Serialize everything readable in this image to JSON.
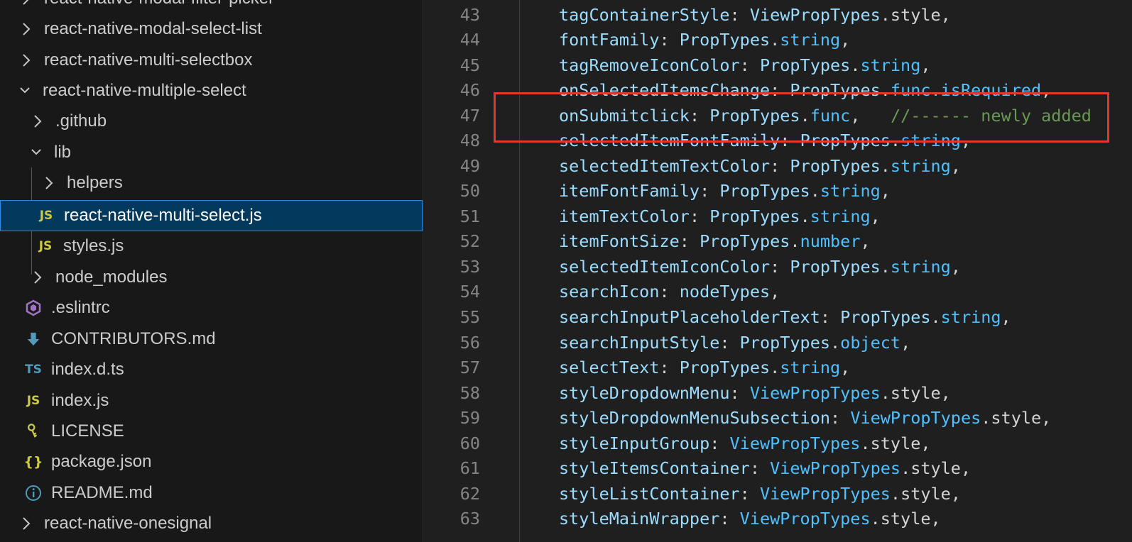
{
  "explorer": {
    "items": [
      {
        "label": "react-native-modal-filter-picker",
        "icon": "chevron-right-icon",
        "kind": "folder"
      },
      {
        "label": "react-native-modal-select-list",
        "icon": "chevron-right-icon",
        "kind": "folder"
      },
      {
        "label": "react-native-multi-selectbox",
        "icon": "chevron-right-icon",
        "kind": "folder"
      },
      {
        "label": "react-native-multiple-select",
        "icon": "chevron-down-icon",
        "kind": "folder"
      },
      {
        "label": ".github",
        "icon": "chevron-right-icon",
        "kind": "folder"
      },
      {
        "label": "lib",
        "icon": "chevron-down-icon",
        "kind": "folder"
      },
      {
        "label": "helpers",
        "icon": "chevron-right-icon",
        "kind": "folder"
      },
      {
        "label": "react-native-multi-select.js",
        "icon": "js-file-icon",
        "badge": "JS",
        "kind": "file",
        "selected": true
      },
      {
        "label": "styles.js",
        "icon": "js-file-icon",
        "badge": "JS",
        "kind": "file"
      },
      {
        "label": "node_modules",
        "icon": "chevron-right-icon",
        "kind": "folder"
      },
      {
        "label": ".eslintrc",
        "icon": "eslint-icon",
        "kind": "file"
      },
      {
        "label": "CONTRIBUTORS.md",
        "icon": "download-arrow-icon",
        "kind": "file"
      },
      {
        "label": "index.d.ts",
        "icon": "ts-file-icon",
        "badge": "TS",
        "kind": "file"
      },
      {
        "label": "index.js",
        "icon": "js-file-icon",
        "badge": "JS",
        "kind": "file"
      },
      {
        "label": "LICENSE",
        "icon": "key-icon",
        "kind": "file"
      },
      {
        "label": "package.json",
        "icon": "json-file-icon",
        "badge": "{}",
        "kind": "file"
      },
      {
        "label": "README.md",
        "icon": "info-icon",
        "kind": "file"
      },
      {
        "label": "react-native-onesignal",
        "icon": "chevron-right-icon",
        "kind": "folder"
      }
    ]
  },
  "editor": {
    "lines": [
      {
        "n": "43",
        "prop": "tagContainerStyle",
        "type": "ViewPropTypes",
        "member": "style",
        "tail": ","
      },
      {
        "n": "44",
        "prop": "fontFamily",
        "type": "PropTypes",
        "member": "string",
        "tail": ","
      },
      {
        "n": "45",
        "prop": "tagRemoveIconColor",
        "type": "PropTypes",
        "member": "string",
        "tail": ","
      },
      {
        "n": "46",
        "prop": "onSelectedItemsChange",
        "type": "PropTypes",
        "member": "func.isRequired",
        "tail": ","
      },
      {
        "n": "47",
        "prop": "onSubmitclick",
        "type": "PropTypes",
        "member": "func",
        "tail": ",",
        "comment": "//------ newly added"
      },
      {
        "n": "48",
        "prop": "selectedItemFontFamily",
        "type": "PropTypes",
        "member": "string",
        "tail": ","
      },
      {
        "n": "49",
        "prop": "selectedItemTextColor",
        "type": "PropTypes",
        "member": "string",
        "tail": ","
      },
      {
        "n": "50",
        "prop": "itemFontFamily",
        "type": "PropTypes",
        "member": "string",
        "tail": ","
      },
      {
        "n": "51",
        "prop": "itemTextColor",
        "type": "PropTypes",
        "member": "string",
        "tail": ","
      },
      {
        "n": "52",
        "prop": "itemFontSize",
        "type": "PropTypes",
        "member": "number",
        "tail": ","
      },
      {
        "n": "53",
        "prop": "selectedItemIconColor",
        "type": "PropTypes",
        "member": "string",
        "tail": ","
      },
      {
        "n": "54",
        "prop": "searchIcon",
        "type": "nodeTypes",
        "member": "",
        "tail": ","
      },
      {
        "n": "55",
        "prop": "searchInputPlaceholderText",
        "type": "PropTypes",
        "member": "string",
        "tail": ","
      },
      {
        "n": "56",
        "prop": "searchInputStyle",
        "type": "PropTypes",
        "member": "object",
        "tail": ","
      },
      {
        "n": "57",
        "prop": "selectText",
        "type": "PropTypes",
        "member": "string",
        "tail": ","
      },
      {
        "n": "58",
        "prop": "styleDropdownMenu",
        "type": "ViewPropTypes",
        "member": "style",
        "tail": ","
      },
      {
        "n": "59",
        "prop": "styleDropdownMenuSubsection",
        "type": "ViewPropTypes",
        "member": "style",
        "tail": ","
      },
      {
        "n": "60",
        "prop": "styleInputGroup",
        "type": "ViewPropTypes",
        "member": "style",
        "tail": ","
      },
      {
        "n": "61",
        "prop": "styleItemsContainer",
        "type": "ViewPropTypes",
        "member": "style",
        "tail": ","
      },
      {
        "n": "62",
        "prop": "styleListContainer",
        "type": "ViewPropTypes",
        "member": "style",
        "tail": ","
      },
      {
        "n": "63",
        "prop": "styleMainWrapper",
        "type": "ViewPropTypes",
        "member": "style",
        "tail": ","
      }
    ]
  },
  "colors": {
    "selection_bg": "#04395e",
    "selection_border": "#2a8ae0",
    "annotation_box": "#e0392b",
    "comment": "#6a9955",
    "type_blue": "#4fc1ff",
    "prop_light_blue": "#9cdcfe"
  }
}
